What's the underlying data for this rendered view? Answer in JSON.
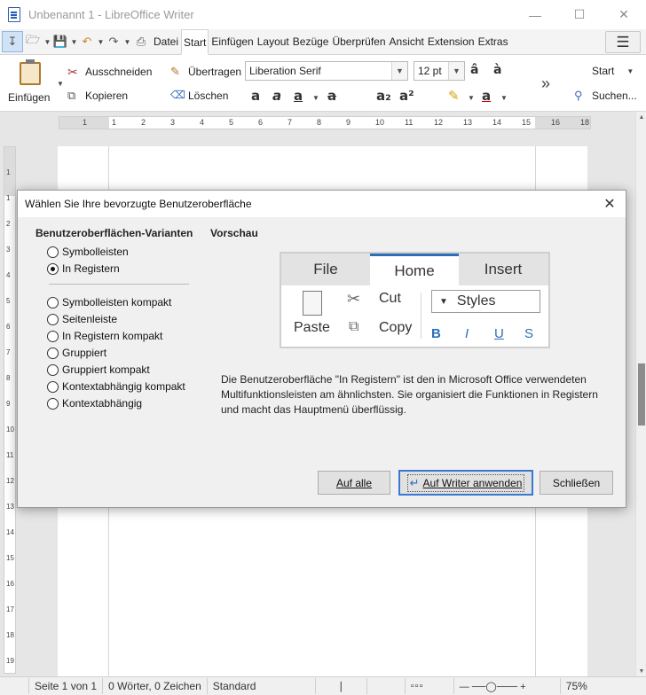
{
  "window": {
    "title": "Unbenannt 1 - LibreOffice Writer",
    "minimize_icon": "minimize-icon",
    "maximize_icon": "maximize-icon",
    "close_icon": "close-icon"
  },
  "tabs": [
    "Datei",
    "Start",
    "Einfügen",
    "Layout",
    "Bezüge",
    "Überprüfen",
    "Ansicht",
    "Extension",
    "Extras"
  ],
  "active_tab": "Start",
  "ribbon": {
    "paste_label": "Einfügen",
    "cut_label": "Ausschneiden",
    "copy_label": "Kopieren",
    "clone_label": "Übertragen",
    "clear_label": "Löschen",
    "font_name": "Liberation Serif",
    "font_size": "12 pt",
    "style_label": "Start",
    "find_label": "Suchen...",
    "more_label": "»"
  },
  "ruler": {
    "numbers": [
      "1",
      "1",
      "2",
      "3",
      "4",
      "5",
      "6",
      "7",
      "8",
      "9",
      "10",
      "11",
      "12",
      "13",
      "14",
      "15",
      "16",
      "18"
    ]
  },
  "vruler": {
    "numbers": [
      "1",
      "1",
      "2",
      "3",
      "4",
      "5",
      "6",
      "7",
      "8",
      "9",
      "10",
      "11",
      "12",
      "13",
      "14",
      "15",
      "16",
      "17",
      "18",
      "19"
    ]
  },
  "statusbar": {
    "page": "Seite 1 von 1",
    "words": "0 Wörter, 0 Zeichen",
    "style": "Standard",
    "zoom": "75%"
  },
  "dialog": {
    "title": "Wählen Sie Ihre bevorzugte Benutzeroberfläche",
    "variants_label": "Benutzeroberflächen-Varianten",
    "preview_label": "Vorschau",
    "options_group1": [
      "Symbolleisten",
      "In Registern"
    ],
    "options_group2": [
      "Symbolleisten kompakt",
      "Seitenleiste",
      "In Registern kompakt",
      "Gruppiert",
      "Gruppiert kompakt",
      "Kontextabhängig kompakt",
      "Kontextabhängig"
    ],
    "selected_option": "In Registern",
    "preview": {
      "tabs": [
        "File",
        "Home",
        "Insert"
      ],
      "active_tab": "Home",
      "paste": "Paste",
      "cut": "Cut",
      "copy": "Copy",
      "styles": "Styles",
      "bold": "B",
      "italic": "I",
      "underline": "U",
      "strike": "S"
    },
    "description": "Die Benutzeroberfläche \"In Registern\" ist den in Microsoft Office verwendeten Multifunktionsleisten am ähnlichsten. Sie organisiert die Funktionen in Registern und macht das Hauptmenü überflüssig.",
    "buttons": {
      "apply_all": "Auf alle",
      "apply_writer": "Auf Writer anwenden",
      "close": "Schließen"
    }
  }
}
